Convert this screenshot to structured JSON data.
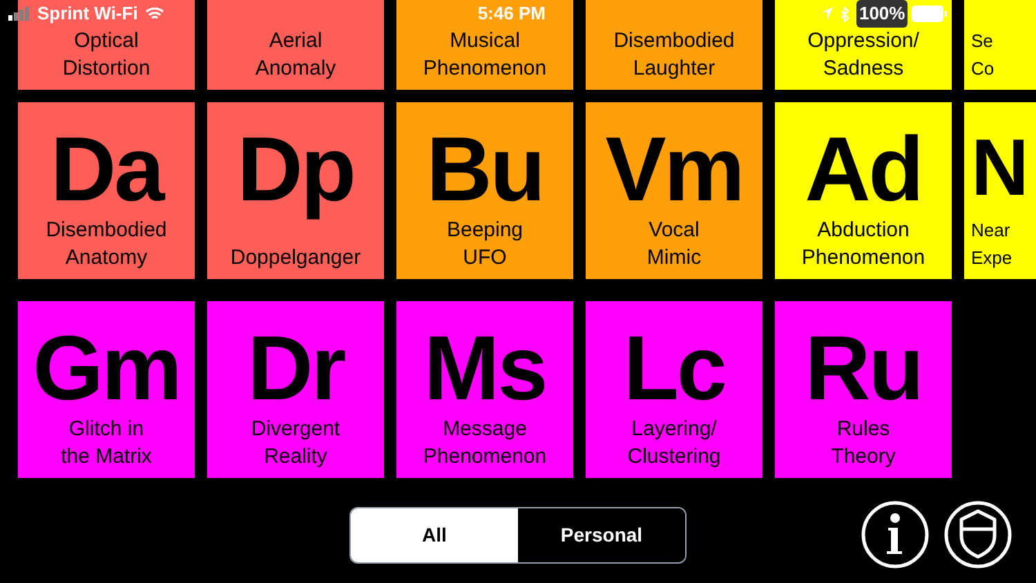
{
  "status_bar": {
    "carrier": "Sprint Wi-Fi",
    "time": "5:46 PM",
    "battery": "100%"
  },
  "rows": [
    {
      "tiles": [
        {
          "name": [
            "Optical",
            "Distortion"
          ],
          "color": "#fd5e57"
        },
        {
          "name": [
            "Aerial",
            "Anomaly"
          ],
          "color": "#fd5e57"
        },
        {
          "name": [
            "Musical",
            "Phenomenon"
          ],
          "color": "#ff9f0a"
        },
        {
          "name": [
            "Disembodied",
            "Laughter"
          ],
          "color": "#ff9f0a"
        },
        {
          "name": [
            "Oppression/",
            "Sadness"
          ],
          "color": "#ffff00"
        },
        {
          "kind": "partial",
          "name": [
            "Se",
            "Co"
          ],
          "color": "#ffff00"
        }
      ]
    },
    {
      "tiles": [
        {
          "symbol": "Da",
          "name": [
            "Disembodied",
            "Anatomy"
          ],
          "color": "#fd5e57"
        },
        {
          "symbol": "Dp",
          "name": [
            "Doppelganger"
          ],
          "color": "#fd5e57"
        },
        {
          "symbol": "Bu",
          "name": [
            "Beeping",
            "UFO"
          ],
          "color": "#ff9f0a"
        },
        {
          "symbol": "Vm",
          "name": [
            "Vocal",
            "Mimic"
          ],
          "color": "#ff9f0a"
        },
        {
          "symbol": "Ad",
          "name": [
            "Abduction",
            "Phenomenon"
          ],
          "color": "#ffff00"
        },
        {
          "kind": "partial",
          "symbol": "N",
          "name": [
            "Near",
            "Expe"
          ],
          "color": "#ffff00"
        }
      ]
    },
    {
      "tiles": [
        {
          "symbol": "Gm",
          "name": [
            "Glitch in",
            "the Matrix"
          ],
          "color": "#ff00ff"
        },
        {
          "symbol": "Dr",
          "name": [
            "Divergent",
            "Reality"
          ],
          "color": "#ff00ff"
        },
        {
          "symbol": "Ms",
          "name": [
            "Message",
            "Phenomenon"
          ],
          "color": "#ff00ff"
        },
        {
          "symbol": "Lc",
          "name": [
            "Layering/",
            "Clustering"
          ],
          "color": "#ff00ff"
        },
        {
          "symbol": "Ru",
          "name": [
            "Rules",
            "Theory"
          ],
          "color": "#ff00ff"
        }
      ]
    }
  ],
  "segments": [
    {
      "label": "All",
      "selected": true
    },
    {
      "label": "Personal",
      "selected": false
    }
  ]
}
